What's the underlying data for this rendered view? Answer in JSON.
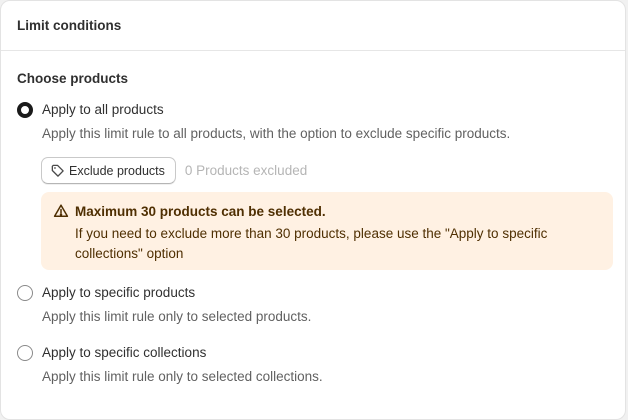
{
  "card": {
    "title": "Limit conditions"
  },
  "section": {
    "title": "Choose products"
  },
  "options": [
    {
      "label": "Apply to all products",
      "description": "Apply this limit rule to all products, with the option to exclude specific products.",
      "checked": true
    },
    {
      "label": "Apply to specific products",
      "description": "Apply this limit rule only to selected products.",
      "checked": false
    },
    {
      "label": "Apply to specific collections",
      "description": "Apply this limit rule only to selected collections.",
      "checked": false
    }
  ],
  "exclude": {
    "button_label": "Exclude products",
    "button_icon": "tag-icon",
    "count_text": "0 Products excluded"
  },
  "banner": {
    "icon": "warning-icon",
    "title": "Maximum 30 products can be selected.",
    "text": "If you need to exclude more than 30 products, please use the \"Apply to specific collections\" option"
  },
  "colors": {
    "banner_bg": "#fff1e3",
    "banner_text": "#4f2f02",
    "muted_text": "#b5b5b5",
    "radio_checked": "#1a1a1a"
  }
}
